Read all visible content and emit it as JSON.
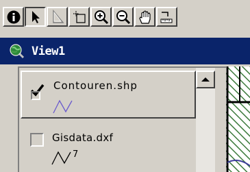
{
  "toolbar": {
    "buttons": [
      {
        "name": "identify",
        "icon": "info-icon"
      },
      {
        "name": "pointer",
        "icon": "pointer-arrow-icon",
        "pressed": true
      },
      {
        "name": "vertex-edit",
        "icon": "vertex-edit-icon"
      },
      {
        "name": "select-feature",
        "icon": "select-feature-icon"
      },
      {
        "name": "zoom-in",
        "icon": "zoom-in-icon"
      },
      {
        "name": "zoom-out",
        "icon": "zoom-out-icon"
      },
      {
        "name": "pan",
        "icon": "pan-hand-icon"
      },
      {
        "name": "measure",
        "icon": "measure-icon"
      }
    ]
  },
  "window": {
    "title": "View1",
    "icon": "view-globe-icon",
    "titlebar_color": "#0a246a"
  },
  "toc": {
    "layers": [
      {
        "name": "Contouren.shp",
        "visible": true,
        "legend_symbol": "line-symbol",
        "legend_color": "#6a5acd",
        "legend_label": ""
      },
      {
        "name": "Gisdata.dxf",
        "visible": false,
        "legend_symbol": "line-symbol",
        "legend_color": "#000000",
        "legend_label": "7"
      }
    ]
  },
  "map": {
    "hatch_color": "#3c7a3c"
  }
}
